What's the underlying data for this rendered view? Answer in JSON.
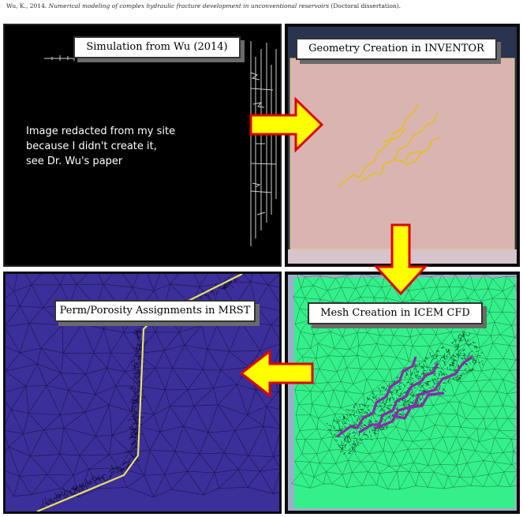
{
  "citation": {
    "author_year": "Wu, K., 2014.",
    "title": "Numerical modeling of complex hydraulic fracture development in unconventional reservoirs",
    "suffix": "(Doctoral dissertation)."
  },
  "panels": {
    "simulation": {
      "label": "Simulation from Wu (2014)",
      "note_lines": [
        "Image redacted from my site",
        "because I didn't create it,",
        "see Dr. Wu's paper"
      ]
    },
    "geometry": {
      "label": "Geometry Creation in INVENTOR"
    },
    "perm": {
      "label": "Perm/Porosity Assignments in MRST"
    },
    "mesh": {
      "label": "Mesh Creation in ICEM CFD"
    }
  },
  "colors": {
    "arrow_fill": "#ffff00",
    "arrow_stroke": "#e00000",
    "geometry_bg": "#d9b4b0",
    "fracture_yellow": "#e6c200",
    "mrst_bg": "#3b2f9a",
    "mesh_bg": "#33f08a",
    "mesh_fracture": "#8a2aa8"
  }
}
